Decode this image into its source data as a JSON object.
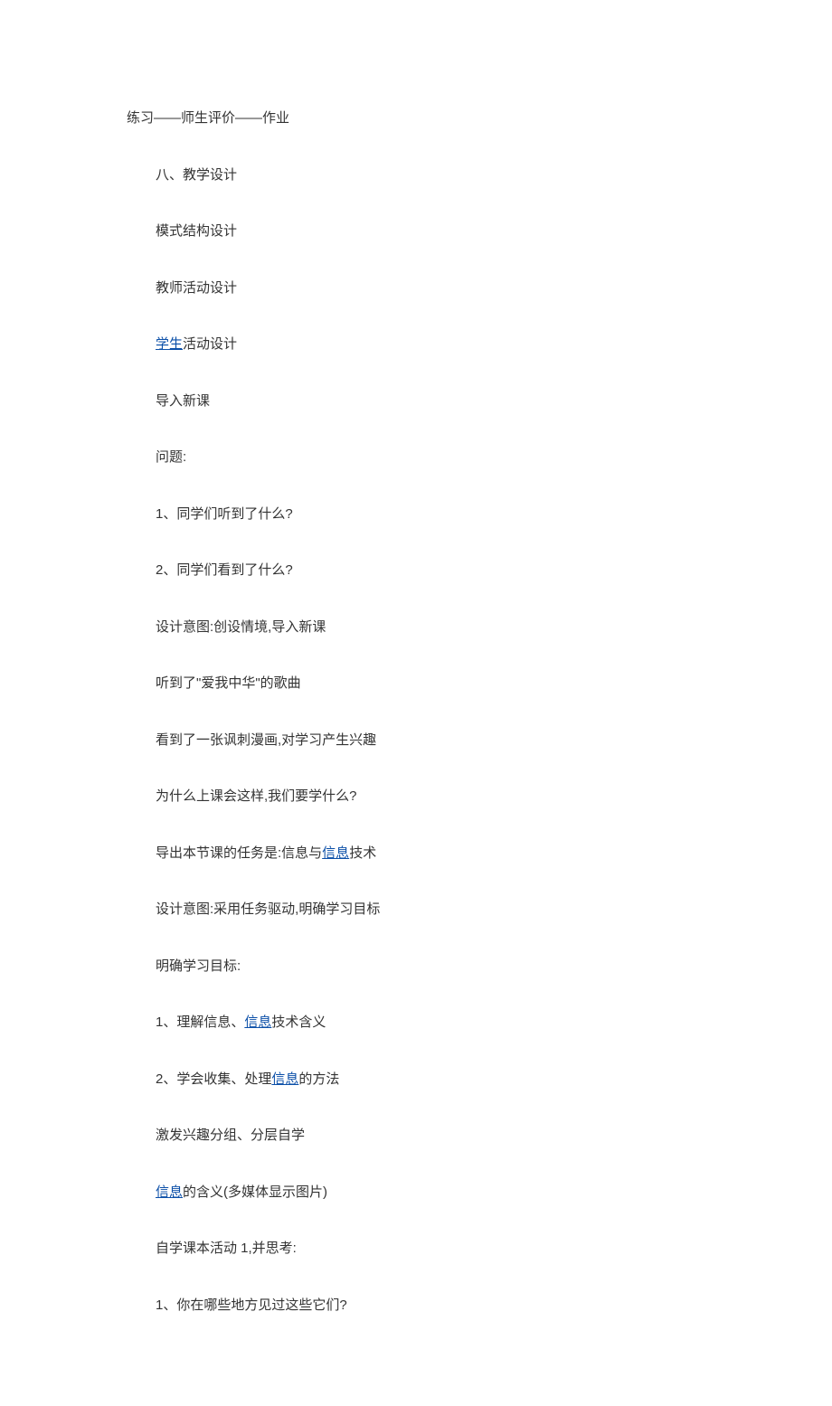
{
  "firstLine": {
    "text": "练习——师生评价——作业"
  },
  "lines": [
    {
      "type": "text",
      "parts": [
        {
          "t": "plain",
          "v": "八、教学设计"
        }
      ]
    },
    {
      "type": "text",
      "parts": [
        {
          "t": "plain",
          "v": "模式结构设计"
        }
      ]
    },
    {
      "type": "text",
      "parts": [
        {
          "t": "plain",
          "v": "教师活动设计"
        }
      ]
    },
    {
      "type": "text",
      "parts": [
        {
          "t": "link",
          "v": "学生"
        },
        {
          "t": "plain",
          "v": "活动设计"
        }
      ]
    },
    {
      "type": "text",
      "parts": [
        {
          "t": "plain",
          "v": "导入新课"
        }
      ]
    },
    {
      "type": "text",
      "parts": [
        {
          "t": "plain",
          "v": "问题:"
        }
      ]
    },
    {
      "type": "text",
      "parts": [
        {
          "t": "plain",
          "v": "1、同学们听到了什么?"
        }
      ]
    },
    {
      "type": "text",
      "parts": [
        {
          "t": "plain",
          "v": "2、同学们看到了什么?"
        }
      ]
    },
    {
      "type": "text",
      "parts": [
        {
          "t": "plain",
          "v": "设计意图:创设情境,导入新课"
        }
      ]
    },
    {
      "type": "text",
      "parts": [
        {
          "t": "plain",
          "v": "听到了\"爱我中华\"的歌曲"
        }
      ]
    },
    {
      "type": "text",
      "parts": [
        {
          "t": "plain",
          "v": "看到了一张讽刺漫画,对学习产生兴趣"
        }
      ]
    },
    {
      "type": "text",
      "parts": [
        {
          "t": "plain",
          "v": "为什么上课会这样,我们要学什么?"
        }
      ]
    },
    {
      "type": "text",
      "parts": [
        {
          "t": "plain",
          "v": "导出本节课的任务是:信息与"
        },
        {
          "t": "link",
          "v": "信息"
        },
        {
          "t": "plain",
          "v": "技术"
        }
      ]
    },
    {
      "type": "text",
      "parts": [
        {
          "t": "plain",
          "v": "设计意图:采用任务驱动,明确学习目标"
        }
      ]
    },
    {
      "type": "text",
      "parts": [
        {
          "t": "plain",
          "v": "明确学习目标:"
        }
      ]
    },
    {
      "type": "text",
      "parts": [
        {
          "t": "plain",
          "v": "1、理解信息、"
        },
        {
          "t": "link",
          "v": "信息"
        },
        {
          "t": "plain",
          "v": "技术含义"
        }
      ]
    },
    {
      "type": "text",
      "parts": [
        {
          "t": "plain",
          "v": "2、学会收集、处理"
        },
        {
          "t": "link",
          "v": "信息"
        },
        {
          "t": "plain",
          "v": "的方法"
        }
      ]
    },
    {
      "type": "text",
      "parts": [
        {
          "t": "plain",
          "v": "激发兴趣分组、分层自学"
        }
      ]
    },
    {
      "type": "text",
      "parts": [
        {
          "t": "link",
          "v": "信息"
        },
        {
          "t": "plain",
          "v": "的含义(多媒体显示图片)"
        }
      ]
    },
    {
      "type": "text",
      "parts": [
        {
          "t": "plain",
          "v": "自学课本活动 1,并思考:"
        }
      ]
    },
    {
      "type": "text",
      "parts": [
        {
          "t": "plain",
          "v": "1、你在哪些地方见过这些它们?"
        }
      ]
    }
  ]
}
